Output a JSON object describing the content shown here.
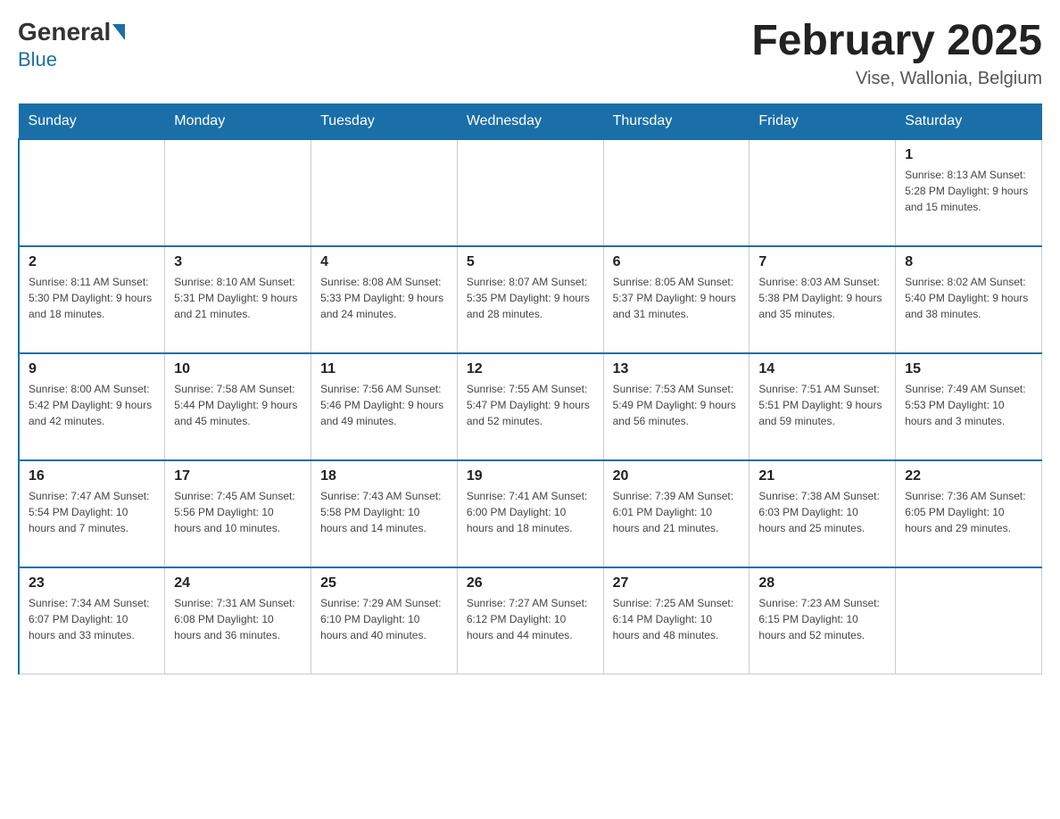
{
  "header": {
    "logo_general": "General",
    "logo_blue": "Blue",
    "title": "February 2025",
    "subtitle": "Vise, Wallonia, Belgium"
  },
  "days_of_week": [
    "Sunday",
    "Monday",
    "Tuesday",
    "Wednesday",
    "Thursday",
    "Friday",
    "Saturday"
  ],
  "weeks": [
    [
      {
        "day": "",
        "info": ""
      },
      {
        "day": "",
        "info": ""
      },
      {
        "day": "",
        "info": ""
      },
      {
        "day": "",
        "info": ""
      },
      {
        "day": "",
        "info": ""
      },
      {
        "day": "",
        "info": ""
      },
      {
        "day": "1",
        "info": "Sunrise: 8:13 AM\nSunset: 5:28 PM\nDaylight: 9 hours and 15 minutes."
      }
    ],
    [
      {
        "day": "2",
        "info": "Sunrise: 8:11 AM\nSunset: 5:30 PM\nDaylight: 9 hours and 18 minutes."
      },
      {
        "day": "3",
        "info": "Sunrise: 8:10 AM\nSunset: 5:31 PM\nDaylight: 9 hours and 21 minutes."
      },
      {
        "day": "4",
        "info": "Sunrise: 8:08 AM\nSunset: 5:33 PM\nDaylight: 9 hours and 24 minutes."
      },
      {
        "day": "5",
        "info": "Sunrise: 8:07 AM\nSunset: 5:35 PM\nDaylight: 9 hours and 28 minutes."
      },
      {
        "day": "6",
        "info": "Sunrise: 8:05 AM\nSunset: 5:37 PM\nDaylight: 9 hours and 31 minutes."
      },
      {
        "day": "7",
        "info": "Sunrise: 8:03 AM\nSunset: 5:38 PM\nDaylight: 9 hours and 35 minutes."
      },
      {
        "day": "8",
        "info": "Sunrise: 8:02 AM\nSunset: 5:40 PM\nDaylight: 9 hours and 38 minutes."
      }
    ],
    [
      {
        "day": "9",
        "info": "Sunrise: 8:00 AM\nSunset: 5:42 PM\nDaylight: 9 hours and 42 minutes."
      },
      {
        "day": "10",
        "info": "Sunrise: 7:58 AM\nSunset: 5:44 PM\nDaylight: 9 hours and 45 minutes."
      },
      {
        "day": "11",
        "info": "Sunrise: 7:56 AM\nSunset: 5:46 PM\nDaylight: 9 hours and 49 minutes."
      },
      {
        "day": "12",
        "info": "Sunrise: 7:55 AM\nSunset: 5:47 PM\nDaylight: 9 hours and 52 minutes."
      },
      {
        "day": "13",
        "info": "Sunrise: 7:53 AM\nSunset: 5:49 PM\nDaylight: 9 hours and 56 minutes."
      },
      {
        "day": "14",
        "info": "Sunrise: 7:51 AM\nSunset: 5:51 PM\nDaylight: 9 hours and 59 minutes."
      },
      {
        "day": "15",
        "info": "Sunrise: 7:49 AM\nSunset: 5:53 PM\nDaylight: 10 hours and 3 minutes."
      }
    ],
    [
      {
        "day": "16",
        "info": "Sunrise: 7:47 AM\nSunset: 5:54 PM\nDaylight: 10 hours and 7 minutes."
      },
      {
        "day": "17",
        "info": "Sunrise: 7:45 AM\nSunset: 5:56 PM\nDaylight: 10 hours and 10 minutes."
      },
      {
        "day": "18",
        "info": "Sunrise: 7:43 AM\nSunset: 5:58 PM\nDaylight: 10 hours and 14 minutes."
      },
      {
        "day": "19",
        "info": "Sunrise: 7:41 AM\nSunset: 6:00 PM\nDaylight: 10 hours and 18 minutes."
      },
      {
        "day": "20",
        "info": "Sunrise: 7:39 AM\nSunset: 6:01 PM\nDaylight: 10 hours and 21 minutes."
      },
      {
        "day": "21",
        "info": "Sunrise: 7:38 AM\nSunset: 6:03 PM\nDaylight: 10 hours and 25 minutes."
      },
      {
        "day": "22",
        "info": "Sunrise: 7:36 AM\nSunset: 6:05 PM\nDaylight: 10 hours and 29 minutes."
      }
    ],
    [
      {
        "day": "23",
        "info": "Sunrise: 7:34 AM\nSunset: 6:07 PM\nDaylight: 10 hours and 33 minutes."
      },
      {
        "day": "24",
        "info": "Sunrise: 7:31 AM\nSunset: 6:08 PM\nDaylight: 10 hours and 36 minutes."
      },
      {
        "day": "25",
        "info": "Sunrise: 7:29 AM\nSunset: 6:10 PM\nDaylight: 10 hours and 40 minutes."
      },
      {
        "day": "26",
        "info": "Sunrise: 7:27 AM\nSunset: 6:12 PM\nDaylight: 10 hours and 44 minutes."
      },
      {
        "day": "27",
        "info": "Sunrise: 7:25 AM\nSunset: 6:14 PM\nDaylight: 10 hours and 48 minutes."
      },
      {
        "day": "28",
        "info": "Sunrise: 7:23 AM\nSunset: 6:15 PM\nDaylight: 10 hours and 52 minutes."
      },
      {
        "day": "",
        "info": ""
      }
    ]
  ]
}
